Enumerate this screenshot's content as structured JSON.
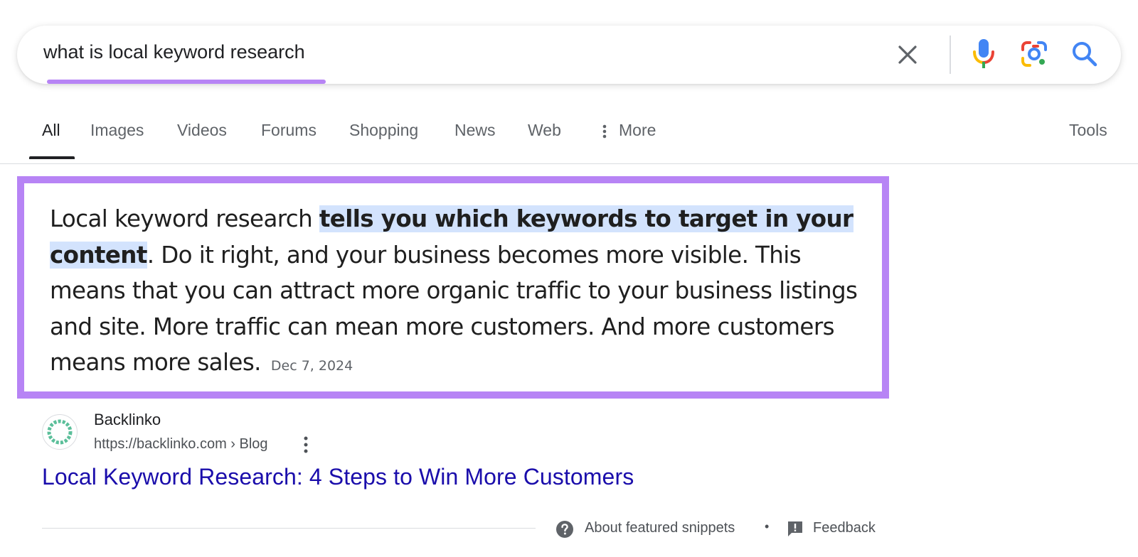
{
  "search": {
    "query": "what is local keyword research",
    "clear_icon": "close-icon",
    "voice_icon": "microphone-icon",
    "lens_icon": "google-lens-icon",
    "search_icon": "search-icon",
    "accent_underline_color": "#b784f5"
  },
  "tabs": {
    "items": [
      "All",
      "Images",
      "Videos",
      "Forums",
      "Shopping",
      "News",
      "Web",
      "More"
    ],
    "active": "All",
    "tools_label": "Tools"
  },
  "snippet": {
    "highlighted_text": "tells you which keywords to target in your content",
    "text_before": "Local keyword research ",
    "text_after": ". Do it right, and your business becomes more visible. This means that you can attract more organic traffic to your business listings and site. More traffic can mean more customers. And more customers means more sales.",
    "date": "Dec 7, 2024",
    "border_color": "#b784f5",
    "highlight_color": "#d3e3fd"
  },
  "source": {
    "site_name": "Backlinko",
    "url": "https://backlinko.com › Blog",
    "title": "Local Keyword Research: 4 Steps to Win More Customers",
    "favicon": "backlinko-logo-icon",
    "title_color": "#1a0dab"
  },
  "footer": {
    "about_label": "About featured snippets",
    "separator": "•",
    "feedback_label": "Feedback"
  }
}
